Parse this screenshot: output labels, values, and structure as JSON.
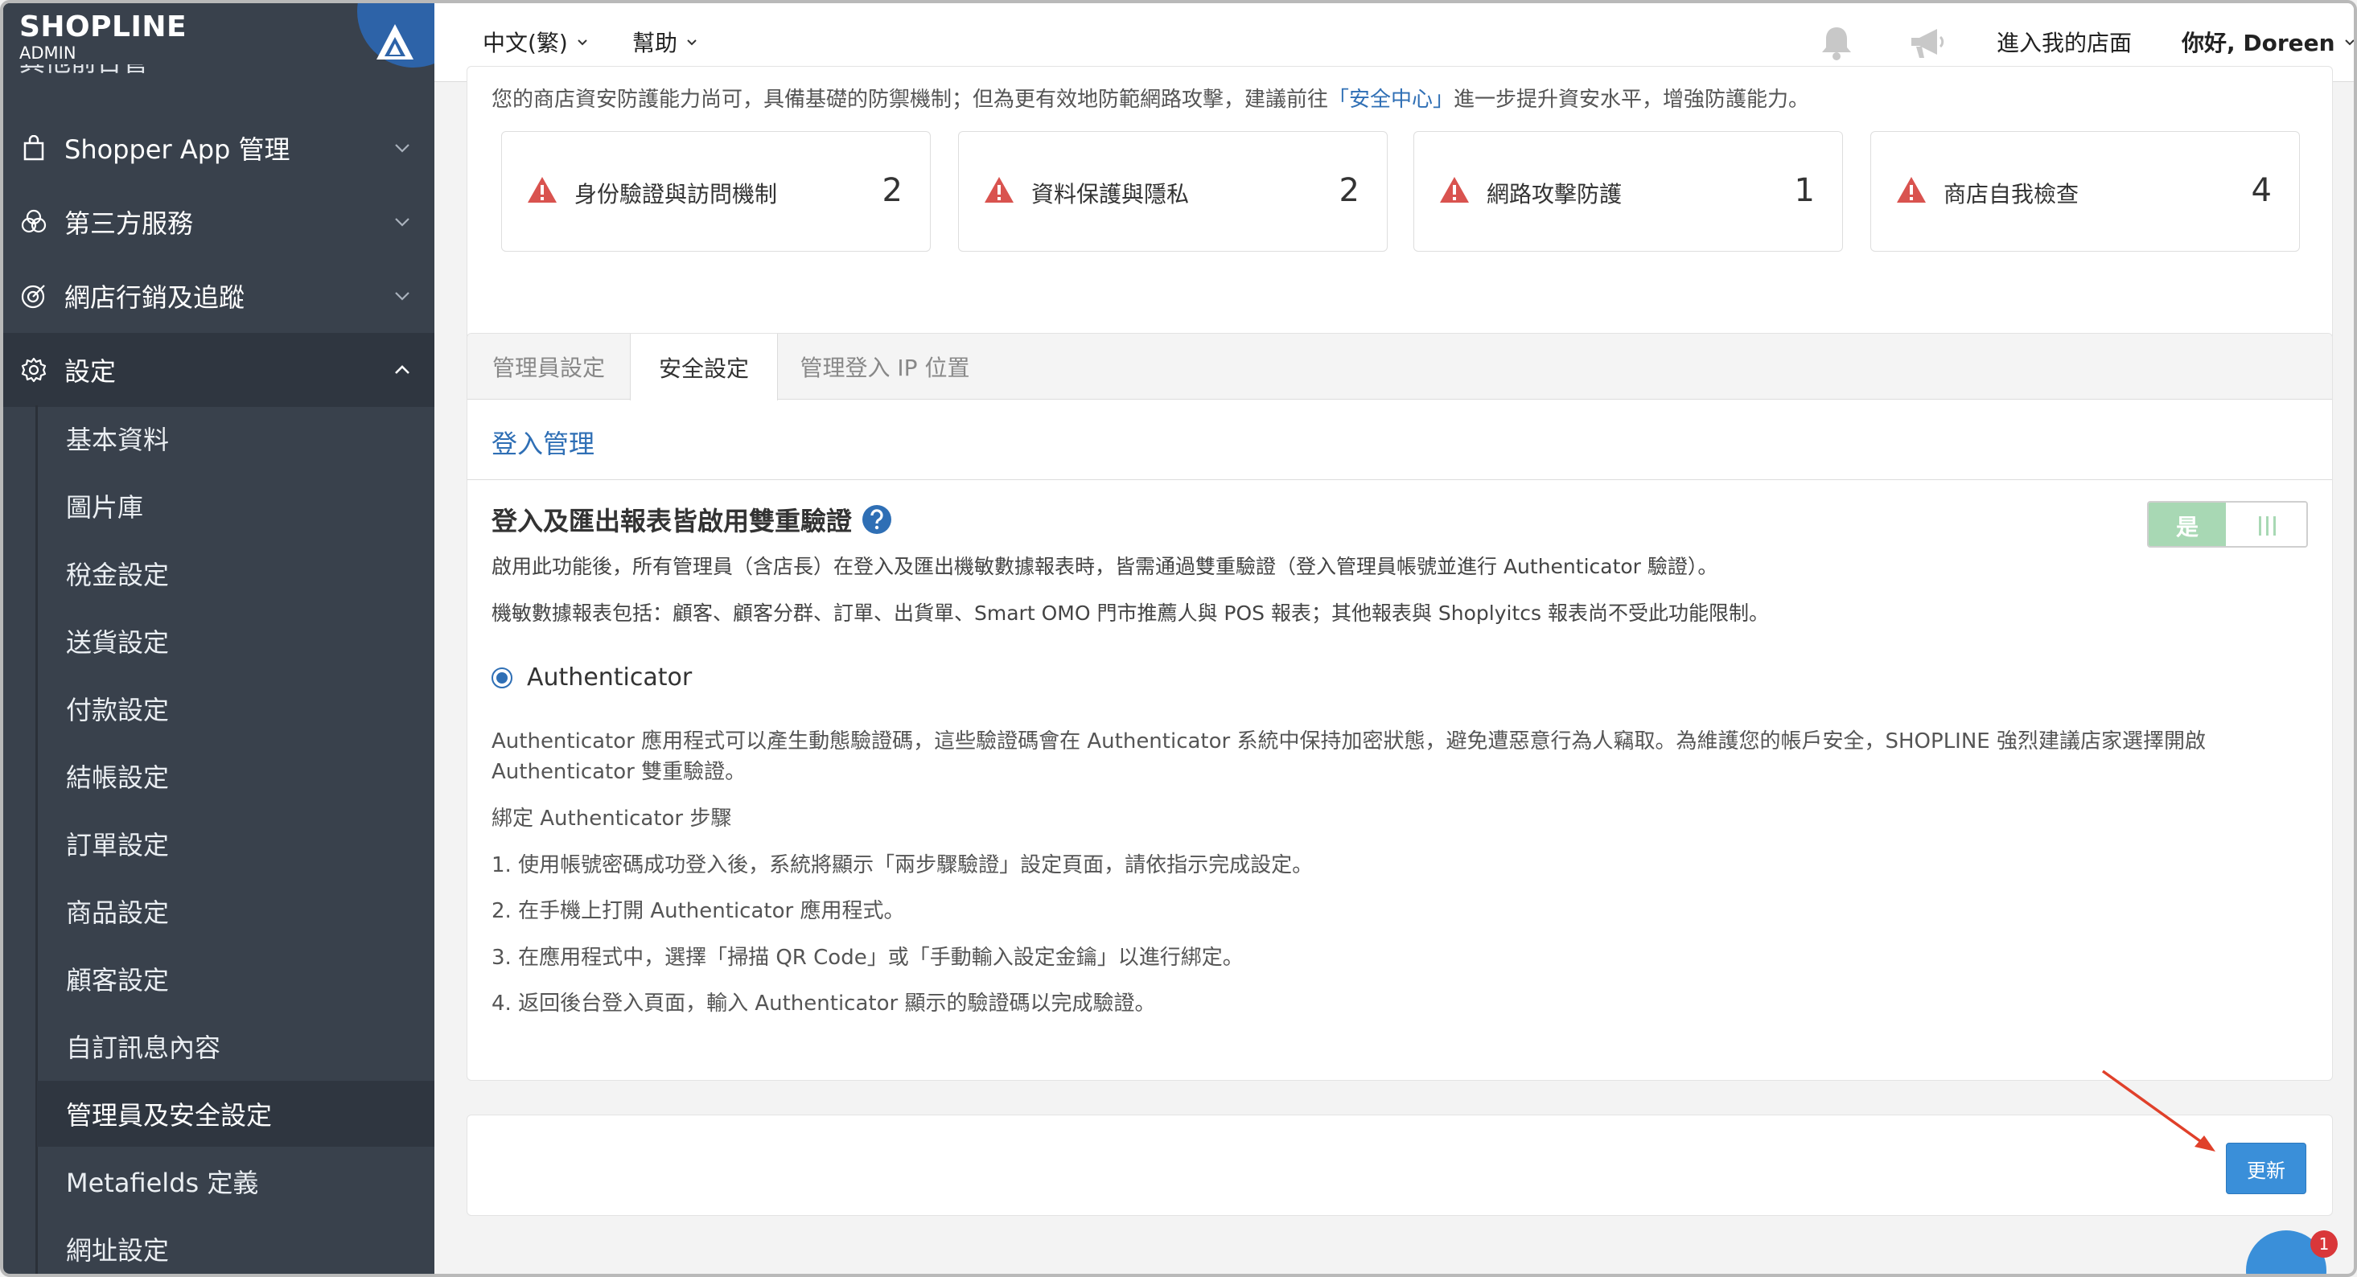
{
  "brand": {
    "logo": "SHOPLINE",
    "sub": "ADMIN",
    "cut_menu_text": "其他前台管理"
  },
  "sidebar": {
    "menu": [
      {
        "label": "Shopper App 管理",
        "icon": "bag-icon"
      },
      {
        "label": "第三方服務",
        "icon": "circles-icon"
      },
      {
        "label": "網店行銷及追蹤",
        "icon": "target-icon"
      },
      {
        "label": "設定",
        "icon": "gear-icon"
      }
    ],
    "submenu": [
      "基本資料",
      "圖片庫",
      "稅金設定",
      "送貨設定",
      "付款設定",
      "結帳設定",
      "訂單設定",
      "商品設定",
      "顧客設定",
      "自訂訊息內容",
      "管理員及安全設定",
      "Metafields 定義",
      "網址設定"
    ],
    "active_submenu": "管理員及安全設定"
  },
  "topbar": {
    "language": "中文(繁)",
    "help": "幫助",
    "visit_store": "進入我的店面",
    "greeting": "你好, Doreen",
    "icons": [
      "bell-icon",
      "megaphone-icon"
    ]
  },
  "security_summary": {
    "notice_prefix": "您的商店資安防護能力尚可，具備基礎的防禦機制；但為更有效地防範網路攻擊，建議前往",
    "notice_link": "「安全中心」",
    "notice_suffix": "進一步提升資安水平，增強防護能力。",
    "items": [
      {
        "label": "身份驗證與訪問機制",
        "count": "2"
      },
      {
        "label": "資料保護與隱私",
        "count": "2"
      },
      {
        "label": "網路攻擊防護",
        "count": "1"
      },
      {
        "label": "商店自我檢查",
        "count": "4"
      }
    ]
  },
  "tabs": [
    {
      "label": "管理員設定",
      "active": false
    },
    {
      "label": "安全設定",
      "active": true
    },
    {
      "label": "管理登入 IP 位置",
      "active": false
    }
  ],
  "login_section": {
    "heading": "登入管理",
    "title": "登入及匯出報表皆啟用雙重驗證",
    "desc1": "啟用此功能後，所有管理員（含店長）在登入及匯出機敏數據報表時，皆需通過雙重驗證（登入管理員帳號並進行 Authenticator 驗證）。",
    "desc2": "機敏數據報表包括：顧客、顧客分群、訂單、出貨單、Smart OMO 門市推薦人與 POS 報表；其他報表與 Shoplyitcs 報表尚不受此功能限制。",
    "toggle_on": "是",
    "toggle_state": true,
    "radio_label": "Authenticator",
    "para1": "Authenticator 應用程式可以產生動態驗證碼，這些驗證碼會在 Authenticator 系統中保持加密狀態，避免遭惡意行為人竊取。為維護您的帳戶安全，SHOPLINE 強烈建議店家選擇開啟",
    "para1b": "Authenticator 雙重驗證。",
    "steps_title": "綁定 Authenticator 步驟",
    "steps": [
      "1. 使用帳號密碼成功登入後，系統將顯示「兩步驟驗證」設定頁面，請依指示完成設定。",
      "2. 在手機上打開 Authenticator 應用程式。",
      "3. 在應用程式中，選擇「掃描 QR Code」或「手動輸入設定金鑰」以進行綁定。",
      "4. 返回後台登入頁面，輸入 Authenticator 顯示的驗證碼以完成驗證。"
    ]
  },
  "actions": {
    "update": "更新"
  },
  "chat": {
    "badge": "1"
  },
  "colors": {
    "sidebar_bg": "#39414c",
    "link": "#2f6fb5",
    "warning": "#d9534f",
    "primary_button": "#3a8fd9",
    "toggle_on": "#a8d8b4",
    "annotation_arrow": "#e0402a"
  }
}
